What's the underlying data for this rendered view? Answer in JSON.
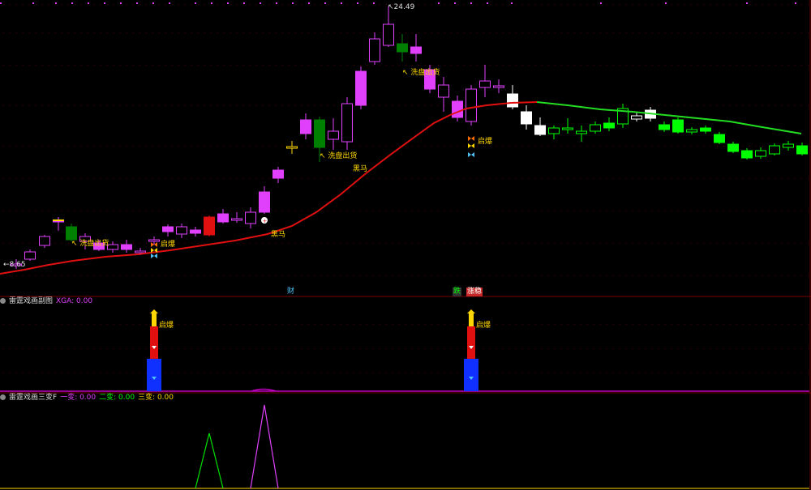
{
  "main_panel": {
    "price_high": "24.49",
    "price_low": "8.65",
    "annotations": [
      {
        "id": "xipan1",
        "text": "↖ 洗盘出货",
        "color": "#ffd700"
      },
      {
        "id": "xipan2",
        "text": "↖ 洗盘出货",
        "color": "#ffd700"
      },
      {
        "id": "xipan3",
        "text": "↖ 洗盘出货",
        "color": "#ffd700"
      },
      {
        "id": "qibao1",
        "text": "启爆",
        "color": "#ffd700"
      },
      {
        "id": "qibao2",
        "text": "启爆",
        "color": "#ffd700"
      },
      {
        "id": "heima1",
        "text": "黑马",
        "color": "#ffd700"
      },
      {
        "id": "heima2",
        "text": "黑马",
        "color": "#ffd700"
      }
    ],
    "bottom_tags": [
      {
        "text": "财",
        "color": "#4fc3f7",
        "bg": "none"
      },
      {
        "text": "跌",
        "color": "#00ff00",
        "bg": "#333"
      },
      {
        "text": "涨稳",
        "color": "#ffffff",
        "bg": "#c62828"
      }
    ]
  },
  "sub_panel_1": {
    "title": "雷霆戏画副图",
    "indicator_label": "XGA: 0.00",
    "indicator_color": "#e040fb",
    "signal_label": "启爆"
  },
  "sub_panel_2": {
    "title": "雷霆戏画三变F",
    "items": [
      {
        "label": "一变: 0.00",
        "color": "#e040fb"
      },
      {
        "label": "二变: 0.00",
        "color": "#00ff00"
      },
      {
        "label": "三变: 0.00",
        "color": "#ffd700"
      }
    ]
  },
  "colors": {
    "ma_up": "#e01010",
    "ma_down": "#22dd22",
    "divider": "#7a0000",
    "grid": "#4a0000"
  }
}
